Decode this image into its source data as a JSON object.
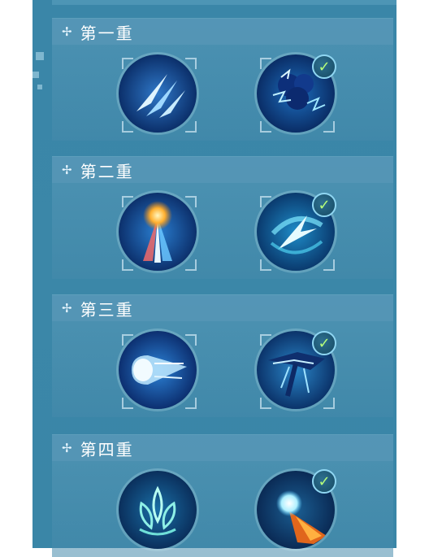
{
  "tiers": [
    {
      "label": "第一重",
      "left_skill": "blade-slash-icon",
      "right_skill": "lightning-fist-icon",
      "right_selected": true
    },
    {
      "label": "第二重",
      "left_skill": "light-burst-icon",
      "right_skill": "spinning-strike-icon",
      "right_selected": true
    },
    {
      "label": "第三重",
      "left_skill": "dash-wave-icon",
      "right_skill": "storm-shatter-icon",
      "right_selected": true
    },
    {
      "label": "第四重",
      "left_skill": "crystal-lotus-icon",
      "right_skill": "fire-comet-icon",
      "right_selected": true
    }
  ],
  "icons": {
    "header_mark": "✢",
    "check": "✓"
  },
  "colors": {
    "panel": "#3a86a8",
    "check": "#b6ff7a"
  }
}
